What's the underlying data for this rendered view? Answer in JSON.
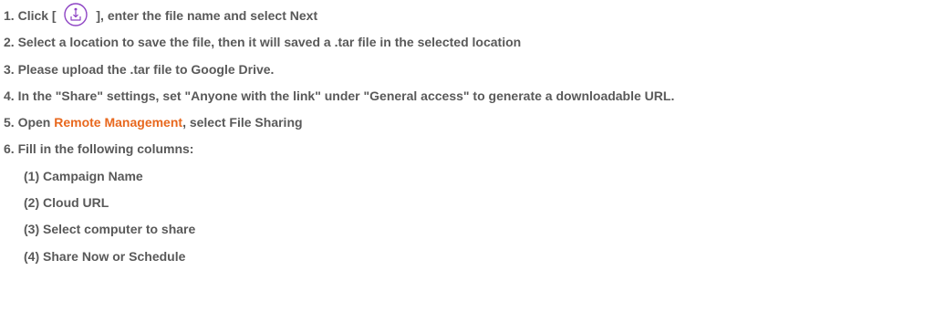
{
  "steps": [
    {
      "number": "1.",
      "before": "Click [",
      "after": "], enter the file name and select Next",
      "icon": "export-icon"
    },
    {
      "number": "2.",
      "text": "Select a location to save the file, then it will saved a .tar file in the selected location"
    },
    {
      "number": "3.",
      "text": "Please upload the .tar file to Google Drive."
    },
    {
      "number": "4.",
      "text": "In the \"Share\" settings, set \"Anyone with the link\" under \"General access\" to generate a downloadable URL."
    },
    {
      "number": "5.",
      "before": "Open",
      "link": "Remote Management",
      "after": ", select File Sharing"
    },
    {
      "number": "6.",
      "text": "Fill in the following columns:"
    }
  ],
  "sub_steps": [
    {
      "number": "(1)",
      "text": "Campaign Name"
    },
    {
      "number": "(2)",
      "text": "Cloud URL"
    },
    {
      "number": "(3)",
      "text": "Select computer to share"
    },
    {
      "number": "(4)",
      "text": "Share Now or Schedule"
    }
  ],
  "colors": {
    "text": "#595959",
    "accent": "#e8681e",
    "icon": "#8e44c4"
  }
}
